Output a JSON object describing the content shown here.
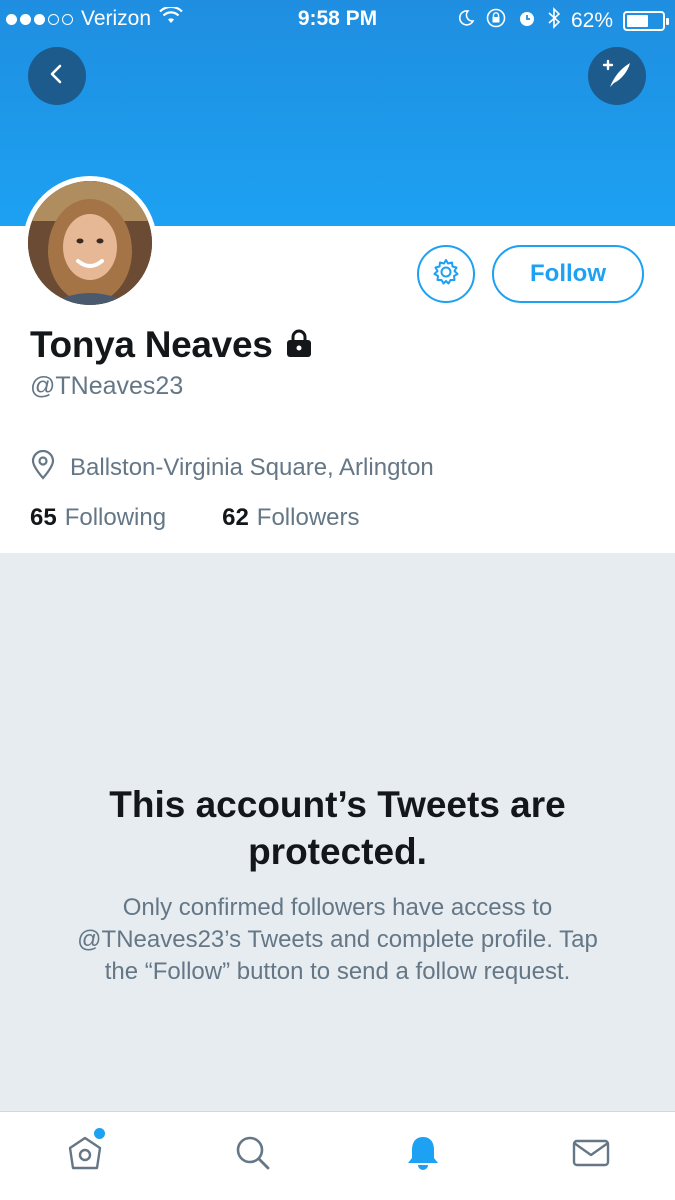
{
  "status_bar": {
    "carrier": "Verizon",
    "time": "9:58 PM",
    "battery": "62%",
    "battery_level": 0.62
  },
  "header": {
    "back_icon": "back-arrow-icon",
    "compose_icon": "compose-tweet-icon"
  },
  "profile": {
    "display_name": "Tonya Neaves",
    "handle": "@TNeaves23",
    "protected_icon": "lock-icon",
    "location": "Ballston-Virginia Square, Arlington",
    "following_count": "65",
    "following_label": "Following",
    "followers_count": "62",
    "followers_label": "Followers"
  },
  "actions": {
    "follow_label": "Follow",
    "settings_icon": "gear-icon"
  },
  "protected_notice": {
    "title": "This account’s Tweets are protected.",
    "body": "Only confirmed followers have access to @TNeaves23’s Tweets and complete profile. Tap the “Follow” button to send a follow request."
  },
  "tab_bar": {
    "tabs": [
      "home-icon",
      "search-icon",
      "notifications-icon",
      "messages-icon"
    ],
    "active": "notifications-icon"
  },
  "colors": {
    "accent": "#1da1f2",
    "secondary_text": "#657786",
    "protected_bg": "#e6ecf0"
  }
}
